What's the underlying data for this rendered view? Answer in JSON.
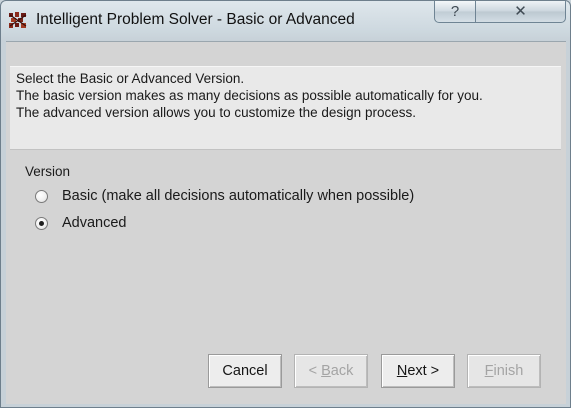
{
  "window": {
    "title": "Intelligent Problem Solver - Basic or Advanced",
    "icon": "app-logo-icon",
    "help_glyph": "?",
    "close_glyph": "✕"
  },
  "info": {
    "lines": [
      "Select the Basic or Advanced Version.",
      "The basic version makes as many decisions as possible automatically for you.",
      "The advanced version allows you to customize the design process."
    ]
  },
  "version_group": {
    "label": "Version",
    "options": [
      {
        "label": "Basic (make all decisions automatically when possible)",
        "selected": false
      },
      {
        "label": "Advanced",
        "selected": true
      }
    ]
  },
  "buttons": {
    "cancel": {
      "label": "Cancel",
      "enabled": true
    },
    "back": {
      "prefix": "< ",
      "accel": "B",
      "rest": "ack",
      "enabled": false
    },
    "next": {
      "accel": "N",
      "rest": "ext >",
      "enabled": true
    },
    "finish": {
      "accel": "F",
      "rest": "inish",
      "enabled": false
    }
  }
}
